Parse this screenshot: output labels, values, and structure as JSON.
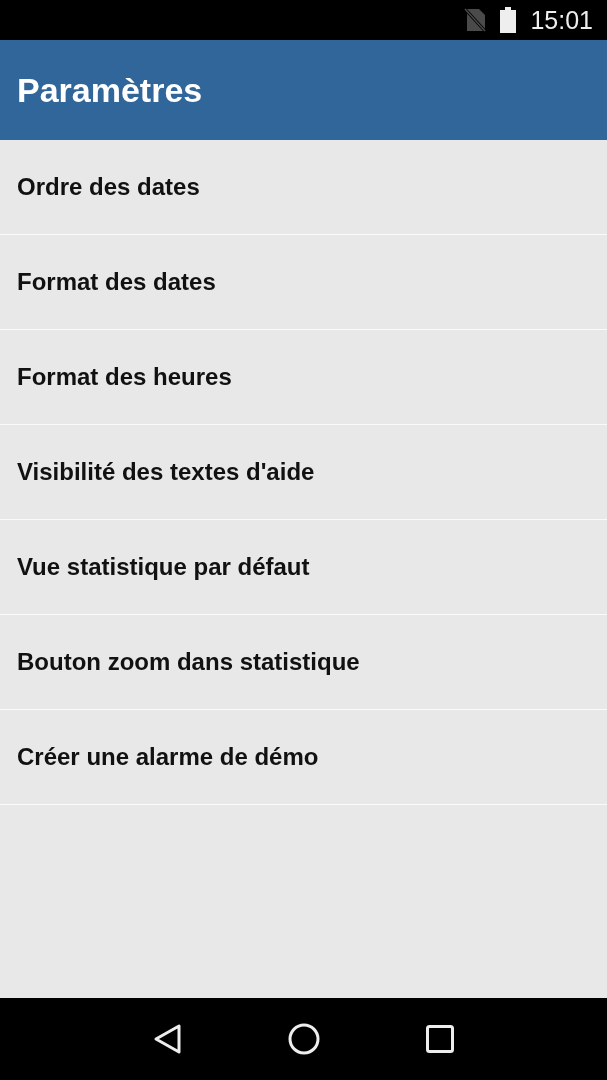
{
  "status_bar": {
    "time": "15:01"
  },
  "app_bar": {
    "title": "Paramètres"
  },
  "settings": [
    {
      "label": "Ordre des dates"
    },
    {
      "label": "Format des dates"
    },
    {
      "label": "Format des heures"
    },
    {
      "label": "Visibilité des textes d'aide"
    },
    {
      "label": "Vue statistique par défaut"
    },
    {
      "label": "Bouton zoom dans statistique"
    },
    {
      "label": "Créer une alarme de démo"
    }
  ]
}
